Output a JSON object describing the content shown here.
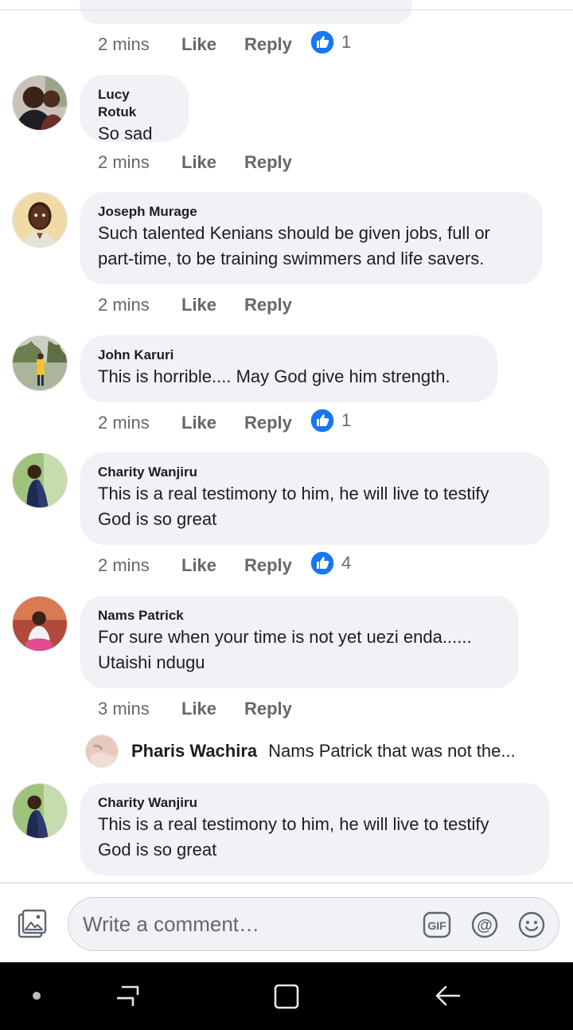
{
  "composer": {
    "placeholder": "Write a comment…",
    "icons": [
      "photo-icon",
      "gif-icon",
      "at-mention-icon",
      "emoji-icon"
    ]
  },
  "actions": {
    "like": "Like",
    "reply": "Reply"
  },
  "top_partial": {
    "time": "2 mins",
    "reaction_count": "1"
  },
  "comments": [
    {
      "author": "Lucy Rotuk",
      "lines": [
        "So sad"
      ],
      "time": "2 mins"
    },
    {
      "author": "Joseph Murage",
      "lines": [
        "Such talented Kenians should be given jobs, full or",
        "part-time, to be training swimmers and life savers."
      ],
      "time": "2 mins"
    },
    {
      "author": "John Karuri",
      "lines": [
        "This is horrible.... May God give him strength."
      ],
      "time": "2 mins",
      "reaction_count": "1"
    },
    {
      "author": "Charity Wanjiru",
      "lines": [
        "This is a real testimony to him, he will live to testify",
        "God is so great"
      ],
      "time": "2 mins",
      "reaction_count": "4"
    },
    {
      "author": "Nams Patrick",
      "lines": [
        "For sure when your time is not yet uezi enda......",
        "Utaishi ndugu"
      ],
      "time": "3 mins"
    },
    {
      "author": "Charity Wanjiru",
      "lines": [
        "This is a real testimony to him, he will live to testify",
        "God is so great"
      ]
    }
  ],
  "reply_preview": {
    "author": "Pharis Wachira",
    "snippet": "Nams Patrick that was not the..."
  },
  "colors": {
    "bubble": "#f0f2f5",
    "like_blue": "#1877f2",
    "meta_gray": "#65676b",
    "nav_bar": "#000000"
  },
  "navbar": {
    "icons": [
      "dot-icon",
      "recent-apps-icon",
      "home-icon",
      "back-icon"
    ]
  }
}
